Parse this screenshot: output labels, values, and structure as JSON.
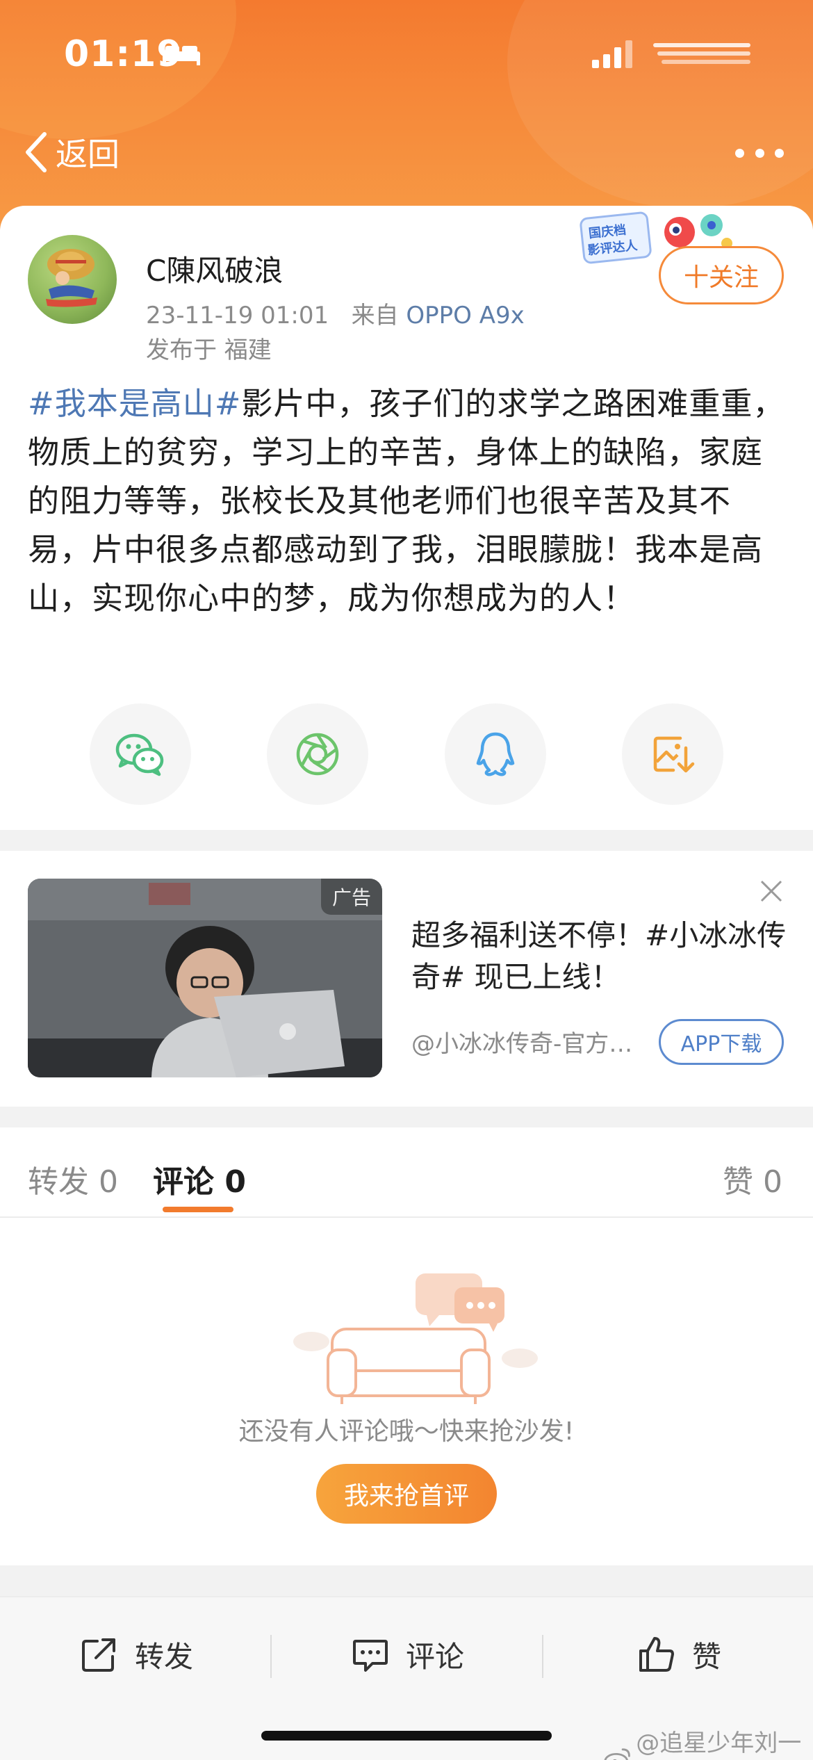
{
  "status_bar": {
    "time": "01:19"
  },
  "nav": {
    "back_label": "返回"
  },
  "post": {
    "username": "C陳风破浪",
    "timestamp": "23-11-19 01:01",
    "source_prefix": "来自",
    "device": "OPPO A9x",
    "location": "发布于 福建",
    "follow_label": "十关注",
    "badge_text": "国庆档影评达人",
    "topic": "#我本是高山#",
    "body": "影片中，孩子们的求学之路困难重重，物质上的贫穷，学习上的辛苦，身体上的缺陷，家庭的阻力等等，张校长及其他老师们也很辛苦及其不易，片中很多点都感动到了我，泪眼朦胧！我本是高山，实现你心中的梦，成为你想成为的人！",
    "share_options": [
      "wechat-icon",
      "moments-icon",
      "qq-icon",
      "save-image-icon"
    ]
  },
  "ad": {
    "tag": "广告",
    "title": "超多福利送不停！#小冰冰传奇# 现已上线！",
    "source": "@小冰冰传奇-官方…",
    "download_label": "APP下载"
  },
  "tabs": {
    "repost": "转发 0",
    "comments": "评论 0",
    "likes": "赞 0"
  },
  "empty_state": {
    "message": "还没有人评论哦～快来抢沙发!",
    "button_label": "我来抢首评"
  },
  "bottom_bar": {
    "repost": "转发",
    "comment": "评论",
    "like": "赞"
  },
  "watermark": "@追星少年刘一博",
  "colors": {
    "accent": "#f27b2d",
    "topic_link": "#4e78b4",
    "download_blue": "#4f7fc8"
  }
}
